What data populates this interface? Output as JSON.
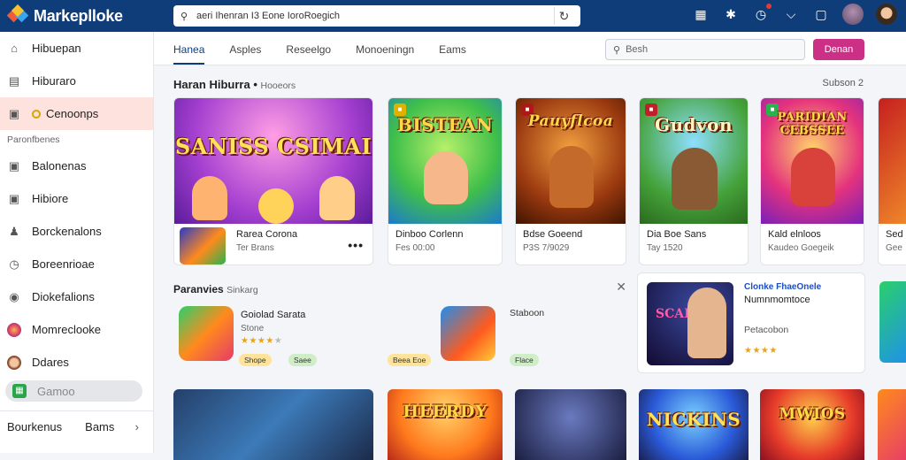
{
  "app": {
    "title": "Markeplloke"
  },
  "address_bar": {
    "url": "aeri Ihenran I3 Eone IoroRoegich"
  },
  "top_icons": [
    "grid-icon",
    "puzzle-icon",
    "notification-icon",
    "chevron-icon",
    "chat-icon",
    "user-icon"
  ],
  "sidebar": {
    "items": [
      {
        "label": "Hibuepan",
        "icon": "home-icon"
      },
      {
        "label": "Hiburaro",
        "icon": "archive-icon"
      },
      {
        "label": "Cenoonps",
        "icon": "image-icon",
        "active": true
      },
      {
        "label": "Balonenas",
        "icon": "image-icon"
      },
      {
        "label": "Hibiore",
        "icon": "bookmark-icon"
      },
      {
        "label": "Borckenalons",
        "icon": "person-icon"
      },
      {
        "label": "Boreenrioae",
        "icon": "clock-icon"
      },
      {
        "label": "Diokefalions",
        "icon": "location-icon"
      },
      {
        "label": "Momreclooke",
        "icon": "app-icon"
      },
      {
        "label": "Ddares",
        "icon": "avatar-icon"
      },
      {
        "label": "Gamoo",
        "icon": "game-icon"
      }
    ],
    "section_label": "Paronfbenes",
    "footer": {
      "left": "Bourkenus",
      "right": "Bams"
    }
  },
  "tabs": [
    "Hanea",
    "Asples",
    "Reseelgo",
    "Monoeningn",
    "Eams"
  ],
  "search": {
    "placeholder": "Besh",
    "button": "Denan"
  },
  "section": {
    "title": "Haran Hiburra",
    "subtitle": "Hooeors",
    "see_all": "Subson 2"
  },
  "cards": [
    {
      "art": "SANISS CSIMAI",
      "title": "Rarea Corona",
      "meta": "Ter Brans"
    },
    {
      "art": "BISTEAN",
      "title": "Dinboo Corlenn",
      "meta": "Fes 00:00"
    },
    {
      "art": "Pauyflcoa",
      "title": "Bdse Goeend",
      "meta": "P3S 7/9029"
    },
    {
      "art": "Gudvon",
      "title": "Dia Boe Sans",
      "meta": "Tay 1520"
    },
    {
      "art": "PARIDIAN CEBSSEE",
      "title": "Kald elnloos",
      "meta": "Kaudeo Goegeik"
    },
    {
      "art": "",
      "title": "Sed",
      "meta": "Gee"
    }
  ],
  "panel": {
    "title": "Paranvies",
    "subtitle": "Sinkarg",
    "app1": {
      "name": "Goiolad Sarata",
      "meta": "Stone",
      "chips": [
        "Shope",
        "Saee"
      ]
    },
    "app2": {
      "name": "Staboon",
      "chips": [
        "Beea Eoe",
        "Flace"
      ]
    }
  },
  "promo": {
    "title": "Clonke FhaeOnele",
    "subtitle": "Numnmomtoce",
    "meta": "Petacobon",
    "art": "SCAES"
  },
  "row2_art": [
    "",
    "HEERDY",
    "",
    "NICKINS",
    "MWIOS",
    ""
  ]
}
